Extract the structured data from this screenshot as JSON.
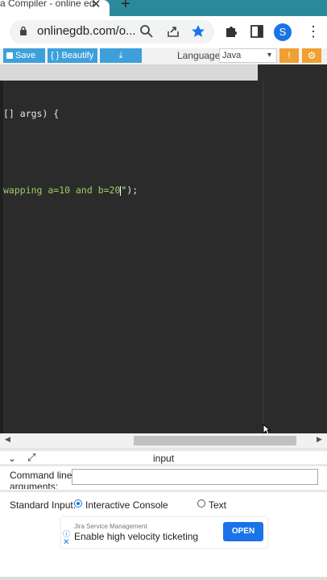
{
  "browser": {
    "tab_title": "a Compiler - online ed",
    "close_glyph": "✕",
    "newtab_glyph": "+",
    "url": "onlinegdb.com/o...",
    "profile_initial": "S",
    "menu_glyph": "⋮"
  },
  "toolbar": {
    "save_label": "Save",
    "beautify_label": "{ } Beautify",
    "download_glyph": "⤓",
    "language_label": "Language",
    "language_value": "Java",
    "info_glyph": "!",
    "settings_glyph": "⚙"
  },
  "editor": {
    "line1": "[] args) {",
    "line2_green": "wapping a=10 and b=20",
    "line2_tail": "\");"
  },
  "input_panel": {
    "title": "input",
    "cmd_label": "Command line arguments:",
    "stdin_label": "Standard Input:",
    "option_interactive": "Interactive Console",
    "option_text": "Text"
  },
  "ad": {
    "sponsor": "Jira Service Management",
    "headline": "Enable high velocity ticketing",
    "cta": "OPEN"
  },
  "colors": {
    "accent_blue": "#3da0da",
    "orange": "#f0a030",
    "editor_bg": "#2b2b2b",
    "string_green": "#9ccc65"
  },
  "icons": [
    "lock-icon",
    "search-icon",
    "share-icon",
    "star-icon",
    "extensions-icon",
    "sidepanel-icon",
    "info-icon",
    "settings-icon",
    "chevron-down-icon",
    "expand-icon",
    "download-icon"
  ]
}
